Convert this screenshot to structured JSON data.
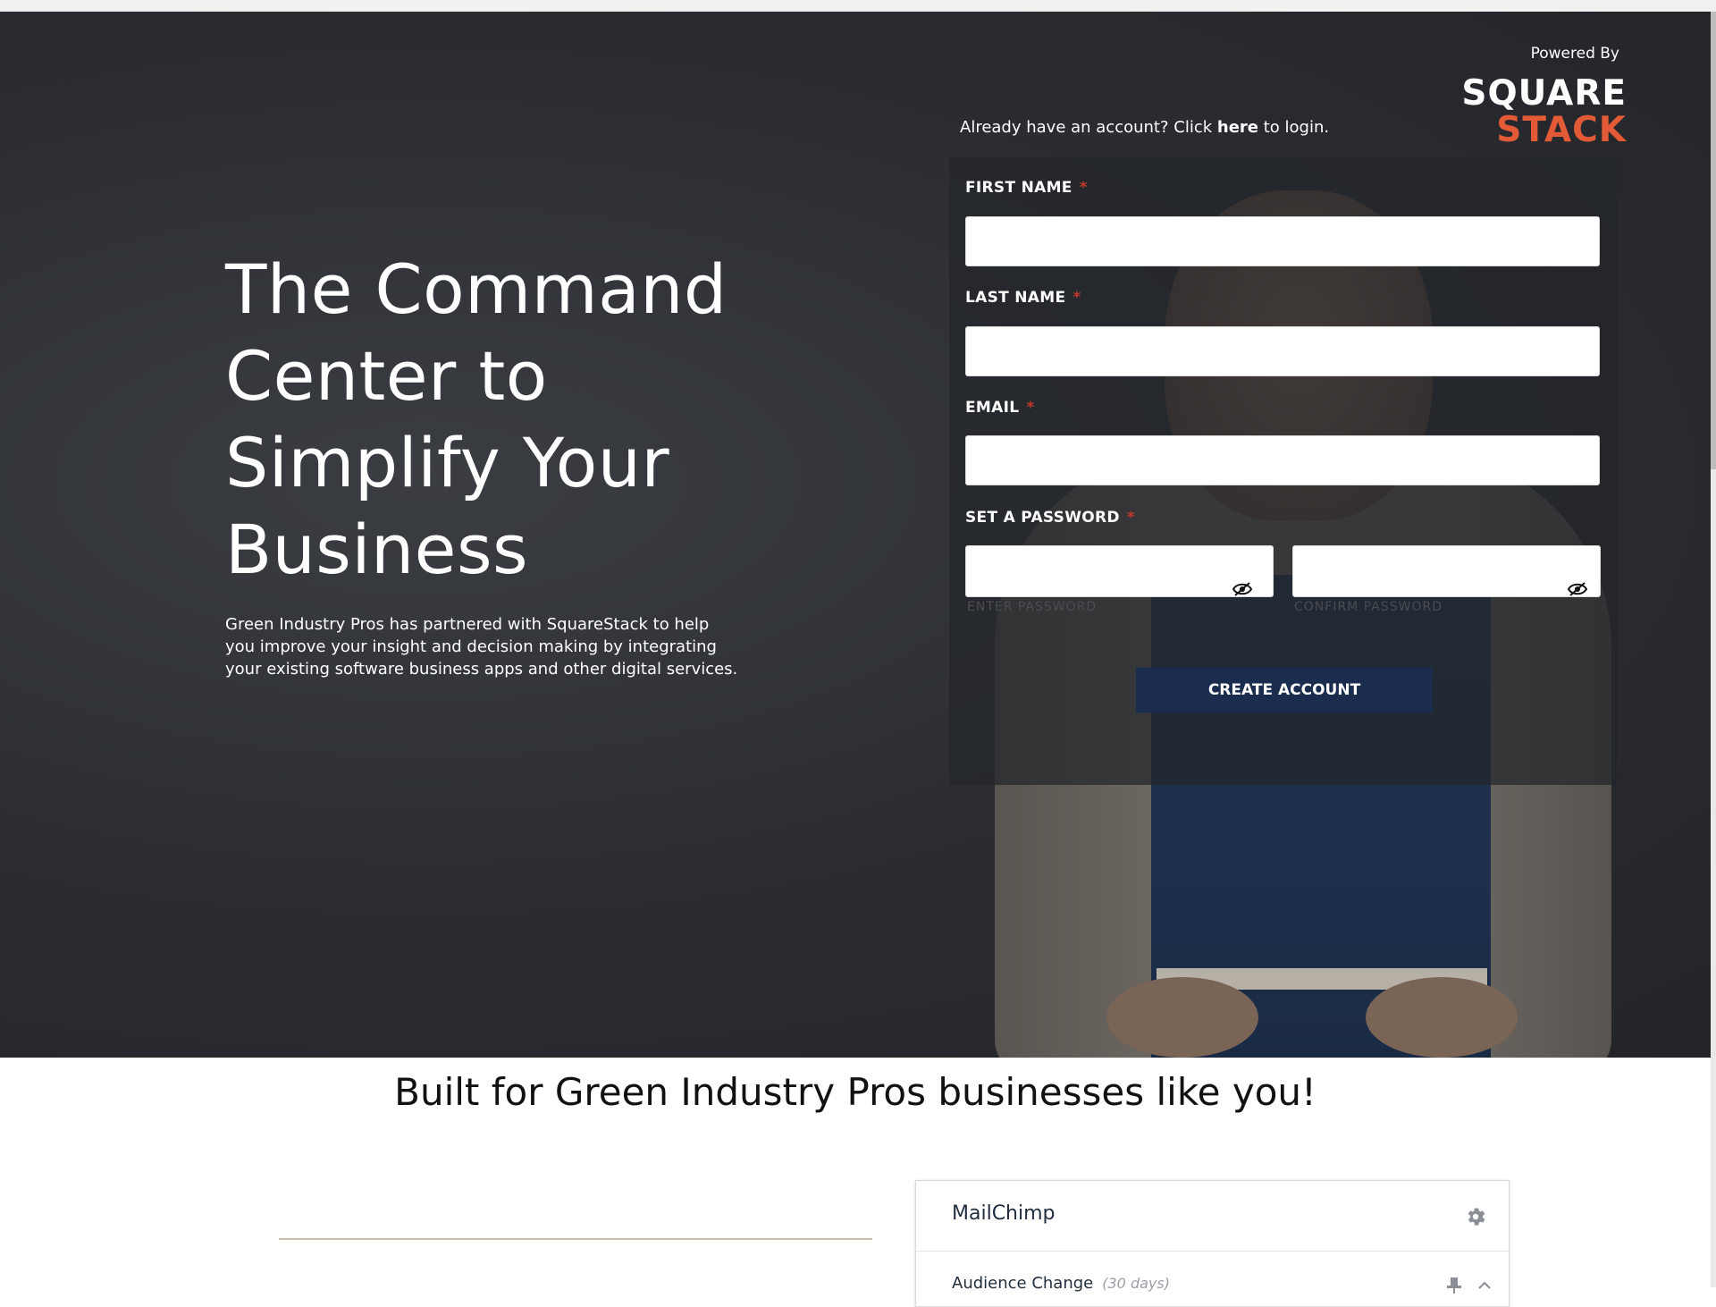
{
  "hero": {
    "headline": "The Command Center to Simplify Your Business",
    "intro": "Green Industry Pros has partnered with SquareStack to help you improve your insight and decision making by integrating your existing software business apps and other digital services."
  },
  "brand": {
    "powered_by": "Powered By",
    "logo_line1": "SQUARE",
    "logo_line2": "STACK",
    "accent_color": "#e35a37"
  },
  "login": {
    "prefix": "Already have an account? Click ",
    "link": "here",
    "suffix": " to login."
  },
  "form": {
    "first_name_label": "FIRST NAME",
    "last_name_label": "LAST NAME",
    "email_label": "EMAIL",
    "password_label": "SET A PASSWORD",
    "required_mark": "*",
    "first_name_value": "",
    "last_name_value": "",
    "email_value": "",
    "password_value": "",
    "confirm_value": "",
    "password_hint": "ENTER PASSWORD",
    "confirm_hint": "CONFIRM PASSWORD",
    "submit_label": "CREATE ACCOUNT",
    "submit_color": "#1a2d4f"
  },
  "section": {
    "title": "Built for Green Industry Pros businesses like you!"
  },
  "integration_card": {
    "title": "MailChimp",
    "row_label": "Audience Change",
    "row_sub": "(30 days)"
  },
  "icons": [
    "gear-icon",
    "eye-slash-icon",
    "pin-icon",
    "chevron-up-icon"
  ]
}
